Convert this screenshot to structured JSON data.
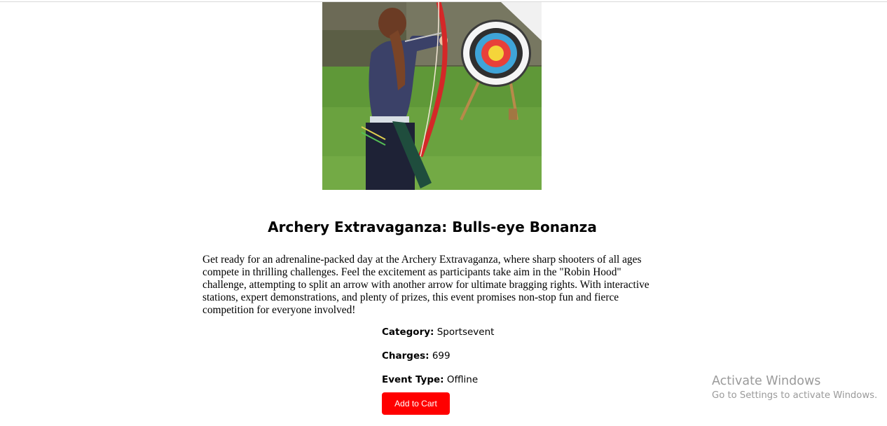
{
  "event": {
    "title": "Archery Extravaganza: Bulls-eye Bonanza",
    "image_alt": "Archer drawing a bow aiming at a target",
    "description": "Get ready for an adrenaline-packed day at the Archery Extravaganza, where sharp shooters of all ages compete in thrilling challenges. Feel the excitement as participants take aim in the \"Robin Hood\" challenge, attempting to split an arrow with another arrow for ultimate bragging rights. With interactive stations, expert demonstrations, and plenty of prizes, this event promises non-stop fun and fierce competition for everyone involved!",
    "category_label": "Category:",
    "category_value": "Sportsevent",
    "charges_label": "Charges:",
    "charges_value": "699",
    "type_label": "Event Type:",
    "type_value": "Offline",
    "add_to_cart_label": "Add to Cart"
  },
  "watermark": {
    "title": "Activate Windows",
    "subtitle": "Go to Settings to activate Windows."
  },
  "colors": {
    "accent": "#ff0000",
    "watermark": "#9a9a9a"
  }
}
